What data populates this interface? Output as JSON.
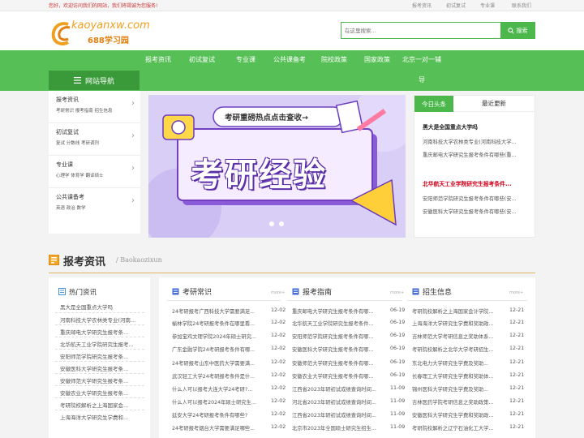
{
  "topbar": {
    "welcome": "您好，欢迎访问我们的网站，我们将竭诚为您服务!",
    "links": [
      "报考资讯",
      "初试复试",
      "专业课",
      "联系我们"
    ]
  },
  "header": {
    "logo_main": "kaoyanxw.com",
    "logo_sub": "688学习园",
    "search_placeholder": "在这里搜索...",
    "search_button": "搜索"
  },
  "nav": {
    "items": [
      "报考资讯",
      "初试复试",
      "专业课",
      "公共课备考",
      "院校政策",
      "国家政策",
      "北京一对一辅"
    ],
    "overflow": "导",
    "sidebar_title": "网站导航"
  },
  "sidebar": [
    {
      "title": "报考资讯",
      "sub": "考研常识 报考指南 招生信息"
    },
    {
      "title": "初试复试",
      "sub": "复试 分数线 考研调剂"
    },
    {
      "title": "专业课",
      "sub": "心理学 体育学 翻译硕士"
    },
    {
      "title": "公共课备考",
      "sub": "英语 政治 数学"
    }
  ],
  "banner": {
    "top_text": "考研重磅热点点击查收→",
    "big_text": "考研经验"
  },
  "news": {
    "tabs": [
      "今日头条",
      "最近更新"
    ],
    "headline1": "黑大是全国重点大学吗",
    "list1": [
      "河南科技大学农林类专业(河南科技大学...",
      "重庆邮电大学研究生报考条件有哪些(重..."
    ],
    "headline2": "北华航天工业学院研究生报考条件...",
    "list2": [
      "安阳师范学院研究生报考条件有哪些(安...",
      "安徽医科大学研究生报考条件有哪些(安..."
    ]
  },
  "section": {
    "title": "报考资讯",
    "subtitle": "/ Baokaozixun"
  },
  "hot": {
    "title": "热门资讯",
    "items": [
      "黑大是全国重点大学吗",
      "河南科技大学农林类专业(河南...",
      "重庆邮电大学研究生报考条...",
      "北华航天工业学院研究生报考...",
      "安阳师范学院研究生报考条...",
      "安徽医科大学研究生报考条...",
      "安徽师范大学研究生报考条...",
      "安徽农业大学研究生报考条...",
      "考研院校解析之上海国家会...",
      "上海海洋大学研究生学费和..."
    ]
  },
  "columns": [
    {
      "title": "考研常识",
      "more": "more+",
      "rows": [
        {
          "t": "24考研报考广西科技大学需要满足...",
          "d": "12-02"
        },
        {
          "t": "榆林学院24考研报考条件在哪里看...",
          "d": "12-02"
        },
        {
          "t": "参加宝鸡文理学院2024年硕士研究...",
          "d": "12-02"
        },
        {
          "t": "广东金融学院24考研报考条件有哪...",
          "d": "12-02"
        },
        {
          "t": "24考研报考山东中医药大学需要满...",
          "d": "12-02"
        },
        {
          "t": "武汉轻工大学24考研报考条件是什...",
          "d": "12-02"
        },
        {
          "t": "什么人可以报考大连大学24考研?...",
          "d": "12-02"
        },
        {
          "t": "什么人可以报考2024年硕士研究生...",
          "d": "12-02"
        },
        {
          "t": "延安大学24考研报考条件有哪些?",
          "d": "12-02"
        },
        {
          "t": "24考研报考烟台大学需要满足哪些...",
          "d": "12-02"
        }
      ]
    },
    {
      "title": "报考指南",
      "more": "more+",
      "rows": [
        {
          "t": "重庆邮电大学研究生报考条件有哪...",
          "d": "06-19"
        },
        {
          "t": "北华航天工业学院研究生报考条件...",
          "d": "06-19"
        },
        {
          "t": "安阳师范学院研究生报考条件有哪...",
          "d": "06-19"
        },
        {
          "t": "安徽医科大学研究生报考条件有哪...",
          "d": "06-19"
        },
        {
          "t": "安徽师范大学研究生报考条件有哪...",
          "d": "06-19"
        },
        {
          "t": "安徽农业大学研究生报考条件有哪...",
          "d": "06-19"
        },
        {
          "t": "江西省2023年研初试成绩查询时间...",
          "d": "11-09"
        },
        {
          "t": "河北省2023年研初试成绩查询时间...",
          "d": "11-09"
        },
        {
          "t": "江西省2023年研初试成绩查询时间...",
          "d": "11-09"
        },
        {
          "t": "北京市2023年全国硕士研究生招生...",
          "d": "11-09"
        }
      ]
    },
    {
      "title": "招生信息",
      "more": "more+",
      "rows": [
        {
          "t": "考研院校解析之上海国家会计学院...",
          "d": "12-21"
        },
        {
          "t": "上海海洋大学研究生学费和奖助政...",
          "d": "12-21"
        },
        {
          "t": "吉林师范大学考研信息之奖助体系...",
          "d": "12-21"
        },
        {
          "t": "考研院校解析之北华大学考研招生...",
          "d": "12-21"
        },
        {
          "t": "东北电力大学研究生学费及奖助...",
          "d": "12-21"
        },
        {
          "t": "长春理工大学研究生学费和奖助体...",
          "d": "12-21"
        },
        {
          "t": "锦州医科大学研究生学费及奖助...",
          "d": "12-21"
        },
        {
          "t": "吉林医药学院考研信息之奖助政策...",
          "d": "12-21"
        },
        {
          "t": "安徽医科大学研究生学费和奖助政...",
          "d": "12-21"
        },
        {
          "t": "考研院校解析之辽宁石油化工大学...",
          "d": "12-21"
        }
      ]
    }
  ],
  "colors": {
    "green": "#56c056",
    "dark_green": "#3a9a3a",
    "red": "#d0021b",
    "gold": "#e0b464"
  },
  "icons": [
    "search-icon",
    "menu-icon",
    "chevron-right-icon",
    "document-icon",
    "news-icon",
    "play-icon"
  ]
}
